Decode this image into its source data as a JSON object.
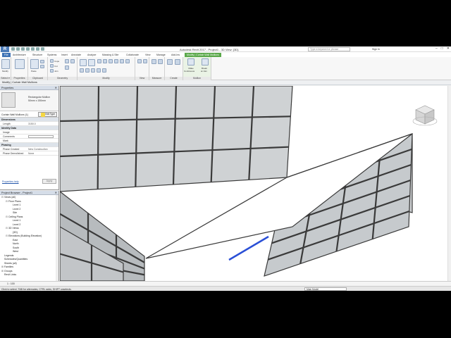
{
  "app": {
    "logo_letter": "R",
    "title": "Autodesk Revit 2017 - Project1 - 3D View: {3D}",
    "search_placeholder": "Type a keyword or phrase",
    "signin": "Sign In",
    "window_controls": [
      "–",
      "□",
      "✕"
    ]
  },
  "tabs": [
    {
      "label": "File",
      "kind": "file"
    },
    {
      "label": "Architecture"
    },
    {
      "label": "Structure"
    },
    {
      "label": "Systems"
    },
    {
      "label": "Insert"
    },
    {
      "label": "Annotate"
    },
    {
      "label": "Analyze"
    },
    {
      "label": "Massing & Site"
    },
    {
      "label": "Collaborate"
    },
    {
      "label": "View"
    },
    {
      "label": "Manage"
    },
    {
      "label": "Add-Ins"
    },
    {
      "label": "Modify | Curtain Wall Mullions",
      "kind": "context"
    }
  ],
  "ribbon": {
    "panels": [
      {
        "label": "Select ▾"
      },
      {
        "label": "Properties"
      },
      {
        "label": "Clipboard"
      },
      {
        "label": "Geometry"
      },
      {
        "label": "Modify"
      },
      {
        "label": "View"
      },
      {
        "label": "Measure"
      },
      {
        "label": "Create"
      },
      {
        "label": "Mullion"
      }
    ],
    "modify_button": "Modify",
    "paste_button": "Paste",
    "cope_label": "Cope",
    "cut_label": "Cut",
    "join_label": "Join",
    "make_continuous": [
      "Make",
      "Continuous"
    ],
    "break_at_join": [
      "Break",
      "at Join"
    ]
  },
  "options_bar": {
    "text": "Modify | Curtain Wall Mullions"
  },
  "properties": {
    "title": "Properties",
    "type_name": "Rectangular Mullion",
    "type_size": "50mm x 150mm",
    "instance_label": "Curtain Wall Mullions (1)",
    "edit_type": "Edit Type",
    "sections": [
      {
        "category": "Dimensions",
        "rows": [
          {
            "k": "Length",
            "v": "3150.0"
          }
        ]
      },
      {
        "category": "Identity Data",
        "rows": [
          {
            "k": "Image",
            "v": ""
          },
          {
            "k": "Comments",
            "v": ""
          },
          {
            "k": "Mark",
            "v": ""
          }
        ]
      },
      {
        "category": "Phasing",
        "rows": [
          {
            "k": "Phase Created",
            "v": "New Construction"
          },
          {
            "k": "Phase Demolished",
            "v": "None"
          }
        ]
      }
    ],
    "help_link": "Properties help",
    "apply": "Apply"
  },
  "browser": {
    "title": "Project Browser - Project1",
    "nodes": [
      {
        "label": "Views (all)",
        "depth": 0,
        "toggle": "⊟"
      },
      {
        "label": "Floor Plans",
        "depth": 1,
        "toggle": "⊟"
      },
      {
        "label": "Level 1",
        "depth": 2,
        "toggle": ""
      },
      {
        "label": "Level 2",
        "depth": 2,
        "toggle": ""
      },
      {
        "label": "Site",
        "depth": 2,
        "toggle": ""
      },
      {
        "label": "Ceiling Plans",
        "depth": 1,
        "toggle": "⊟"
      },
      {
        "label": "Level 1",
        "depth": 2,
        "toggle": ""
      },
      {
        "label": "Level 2",
        "depth": 2,
        "toggle": ""
      },
      {
        "label": "3D Views",
        "depth": 1,
        "toggle": "⊟"
      },
      {
        "label": "{3D}",
        "depth": 2,
        "toggle": ""
      },
      {
        "label": "Elevations (Building Elevation)",
        "depth": 1,
        "toggle": "⊟"
      },
      {
        "label": "East",
        "depth": 2,
        "toggle": ""
      },
      {
        "label": "North",
        "depth": 2,
        "toggle": ""
      },
      {
        "label": "South",
        "depth": 2,
        "toggle": ""
      },
      {
        "label": "West",
        "depth": 2,
        "toggle": ""
      },
      {
        "label": "Legends",
        "depth": 0,
        "toggle": ""
      },
      {
        "label": "Schedules/Quantities",
        "depth": 0,
        "toggle": ""
      },
      {
        "label": "Sheets (all)",
        "depth": 0,
        "toggle": ""
      },
      {
        "label": "Families",
        "depth": 0,
        "toggle": "⊞"
      },
      {
        "label": "Groups",
        "depth": 0,
        "toggle": "⊞"
      },
      {
        "label": "Revit Links",
        "depth": 0,
        "toggle": ""
      }
    ]
  },
  "view_control": {
    "scale": "1 : 100"
  },
  "status": {
    "text": "Click to select, TAB for alternates, CTRL adds, SHIFT unselects.",
    "workset": "Main Model"
  },
  "colors": {
    "ribbon_accent": "#3d72b5",
    "context_tab": "#5aa84a",
    "panel_fill": "#c6cacd",
    "mullion_stroke": "#3a3a3a",
    "selected_mullion": "#2a4fd6"
  },
  "icons": [
    "app-logo-icon",
    "viewcube-icon",
    "close-icon",
    "pencil-cursor-icon"
  ]
}
